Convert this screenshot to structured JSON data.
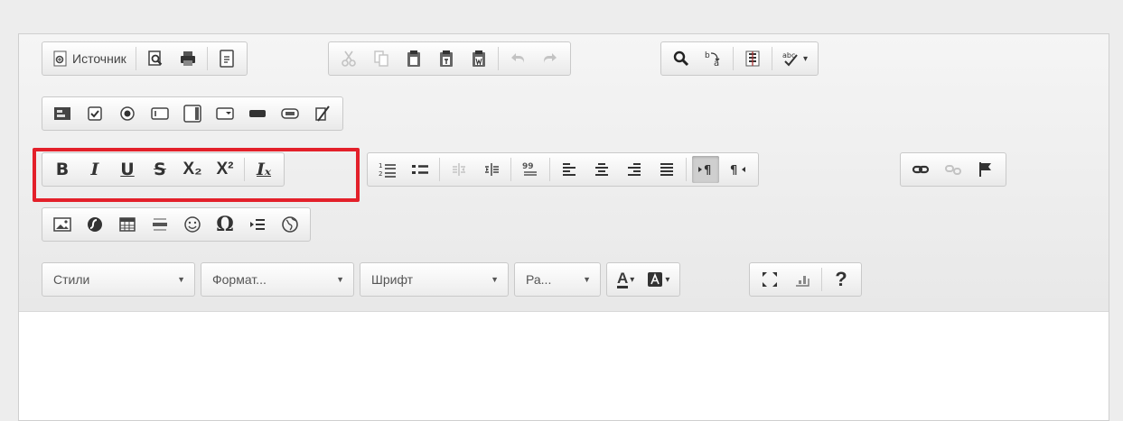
{
  "toolbar": {
    "source_label": "Источник",
    "help_label": "?",
    "combos": {
      "styles": "Стили",
      "format": "Формат...",
      "font": "Шрифт",
      "size": "Ра..."
    },
    "format_buttons": {
      "bold": "B",
      "italic": "I",
      "underline": "U",
      "strike": "S",
      "subscript": "X₂",
      "superscript": "X²",
      "remove_format": "Iₓ"
    },
    "special_char": "Ω",
    "text_color_letter": "A",
    "highlight_color": "#e3202a"
  }
}
